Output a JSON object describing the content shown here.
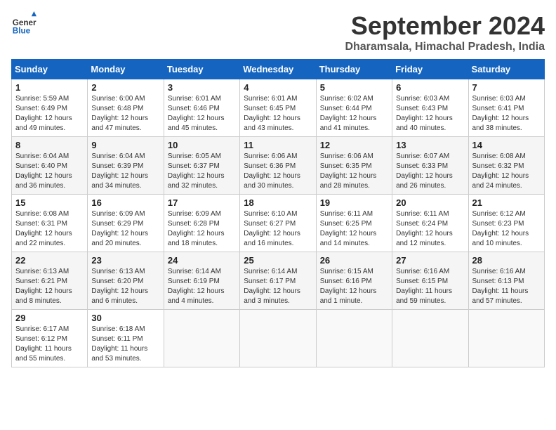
{
  "header": {
    "logo_line1": "General",
    "logo_line2": "Blue",
    "month_year": "September 2024",
    "location": "Dharamsala, Himachal Pradesh, India"
  },
  "days_of_week": [
    "Sunday",
    "Monday",
    "Tuesday",
    "Wednesday",
    "Thursday",
    "Friday",
    "Saturday"
  ],
  "weeks": [
    [
      {
        "day": "1",
        "sunrise": "5:59 AM",
        "sunset": "6:49 PM",
        "daylight": "12 hours and 49 minutes."
      },
      {
        "day": "2",
        "sunrise": "6:00 AM",
        "sunset": "6:48 PM",
        "daylight": "12 hours and 47 minutes."
      },
      {
        "day": "3",
        "sunrise": "6:01 AM",
        "sunset": "6:46 PM",
        "daylight": "12 hours and 45 minutes."
      },
      {
        "day": "4",
        "sunrise": "6:01 AM",
        "sunset": "6:45 PM",
        "daylight": "12 hours and 43 minutes."
      },
      {
        "day": "5",
        "sunrise": "6:02 AM",
        "sunset": "6:44 PM",
        "daylight": "12 hours and 41 minutes."
      },
      {
        "day": "6",
        "sunrise": "6:03 AM",
        "sunset": "6:43 PM",
        "daylight": "12 hours and 40 minutes."
      },
      {
        "day": "7",
        "sunrise": "6:03 AM",
        "sunset": "6:41 PM",
        "daylight": "12 hours and 38 minutes."
      }
    ],
    [
      {
        "day": "8",
        "sunrise": "6:04 AM",
        "sunset": "6:40 PM",
        "daylight": "12 hours and 36 minutes."
      },
      {
        "day": "9",
        "sunrise": "6:04 AM",
        "sunset": "6:39 PM",
        "daylight": "12 hours and 34 minutes."
      },
      {
        "day": "10",
        "sunrise": "6:05 AM",
        "sunset": "6:37 PM",
        "daylight": "12 hours and 32 minutes."
      },
      {
        "day": "11",
        "sunrise": "6:06 AM",
        "sunset": "6:36 PM",
        "daylight": "12 hours and 30 minutes."
      },
      {
        "day": "12",
        "sunrise": "6:06 AM",
        "sunset": "6:35 PM",
        "daylight": "12 hours and 28 minutes."
      },
      {
        "day": "13",
        "sunrise": "6:07 AM",
        "sunset": "6:33 PM",
        "daylight": "12 hours and 26 minutes."
      },
      {
        "day": "14",
        "sunrise": "6:08 AM",
        "sunset": "6:32 PM",
        "daylight": "12 hours and 24 minutes."
      }
    ],
    [
      {
        "day": "15",
        "sunrise": "6:08 AM",
        "sunset": "6:31 PM",
        "daylight": "12 hours and 22 minutes."
      },
      {
        "day": "16",
        "sunrise": "6:09 AM",
        "sunset": "6:29 PM",
        "daylight": "12 hours and 20 minutes."
      },
      {
        "day": "17",
        "sunrise": "6:09 AM",
        "sunset": "6:28 PM",
        "daylight": "12 hours and 18 minutes."
      },
      {
        "day": "18",
        "sunrise": "6:10 AM",
        "sunset": "6:27 PM",
        "daylight": "12 hours and 16 minutes."
      },
      {
        "day": "19",
        "sunrise": "6:11 AM",
        "sunset": "6:25 PM",
        "daylight": "12 hours and 14 minutes."
      },
      {
        "day": "20",
        "sunrise": "6:11 AM",
        "sunset": "6:24 PM",
        "daylight": "12 hours and 12 minutes."
      },
      {
        "day": "21",
        "sunrise": "6:12 AM",
        "sunset": "6:23 PM",
        "daylight": "12 hours and 10 minutes."
      }
    ],
    [
      {
        "day": "22",
        "sunrise": "6:13 AM",
        "sunset": "6:21 PM",
        "daylight": "12 hours and 8 minutes."
      },
      {
        "day": "23",
        "sunrise": "6:13 AM",
        "sunset": "6:20 PM",
        "daylight": "12 hours and 6 minutes."
      },
      {
        "day": "24",
        "sunrise": "6:14 AM",
        "sunset": "6:19 PM",
        "daylight": "12 hours and 4 minutes."
      },
      {
        "day": "25",
        "sunrise": "6:14 AM",
        "sunset": "6:17 PM",
        "daylight": "12 hours and 3 minutes."
      },
      {
        "day": "26",
        "sunrise": "6:15 AM",
        "sunset": "6:16 PM",
        "daylight": "12 hours and 1 minute."
      },
      {
        "day": "27",
        "sunrise": "6:16 AM",
        "sunset": "6:15 PM",
        "daylight": "11 hours and 59 minutes."
      },
      {
        "day": "28",
        "sunrise": "6:16 AM",
        "sunset": "6:13 PM",
        "daylight": "11 hours and 57 minutes."
      }
    ],
    [
      {
        "day": "29",
        "sunrise": "6:17 AM",
        "sunset": "6:12 PM",
        "daylight": "11 hours and 55 minutes."
      },
      {
        "day": "30",
        "sunrise": "6:18 AM",
        "sunset": "6:11 PM",
        "daylight": "11 hours and 53 minutes."
      },
      null,
      null,
      null,
      null,
      null
    ]
  ]
}
